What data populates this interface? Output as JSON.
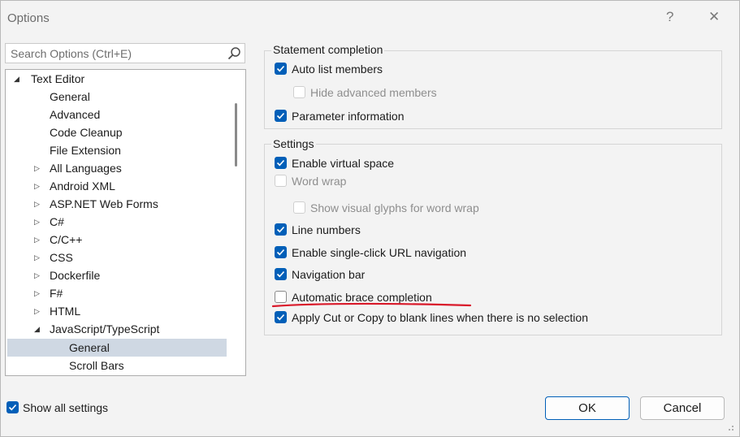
{
  "window": {
    "title": "Options",
    "help_glyph": "?",
    "close_glyph": "✕"
  },
  "search": {
    "placeholder": "Search Options (Ctrl+E)",
    "icon": "search-icon"
  },
  "tree": {
    "items": [
      {
        "label": "Text Editor",
        "arrow": "◢"
      },
      {
        "label": "General"
      },
      {
        "label": "Advanced"
      },
      {
        "label": "Code Cleanup"
      },
      {
        "label": "File Extension"
      },
      {
        "label": "All Languages",
        "arrow": "▷"
      },
      {
        "label": "Android XML",
        "arrow": "▷"
      },
      {
        "label": "ASP.NET Web Forms",
        "arrow": "▷"
      },
      {
        "label": "C#",
        "arrow": "▷"
      },
      {
        "label": "C/C++",
        "arrow": "▷"
      },
      {
        "label": "CSS",
        "arrow": "▷"
      },
      {
        "label": "Dockerfile",
        "arrow": "▷"
      },
      {
        "label": "F#",
        "arrow": "▷"
      },
      {
        "label": "HTML",
        "arrow": "▷"
      },
      {
        "label": "JavaScript/TypeScript",
        "arrow": "◢"
      },
      {
        "label": "General",
        "selected": true
      },
      {
        "label": "Scroll Bars"
      }
    ]
  },
  "statement_completion": {
    "title": "Statement completion",
    "auto_list_members": {
      "label": "Auto list members",
      "checked": true
    },
    "hide_advanced_members": {
      "label": "Hide advanced members",
      "checked": false,
      "disabled": true
    },
    "parameter_information": {
      "label": "Parameter information",
      "checked": true
    }
  },
  "settings": {
    "title": "Settings",
    "enable_virtual_space": {
      "label": "Enable virtual space",
      "checked": true
    },
    "word_wrap": {
      "label": "Word wrap",
      "checked": false,
      "disabled": true
    },
    "show_visual_glyphs": {
      "label": "Show visual glyphs for word wrap",
      "checked": false,
      "disabled": true
    },
    "line_numbers": {
      "label": "Line numbers",
      "checked": true
    },
    "single_click_url": {
      "label": "Enable single-click URL navigation",
      "checked": true
    },
    "navigation_bar": {
      "label": "Navigation bar",
      "checked": true
    },
    "automatic_brace_completion": {
      "label": "Automatic brace completion",
      "checked": false
    },
    "apply_cut_copy": {
      "label": "Apply Cut or Copy to blank lines when there is no selection",
      "checked": true
    }
  },
  "show_all_settings": {
    "label": "Show all settings",
    "checked": true
  },
  "buttons": {
    "ok": "OK",
    "cancel": "Cancel"
  },
  "colors": {
    "accent": "#005fb8",
    "selection": "#cfd8e3",
    "annotation": "#d9192a"
  }
}
